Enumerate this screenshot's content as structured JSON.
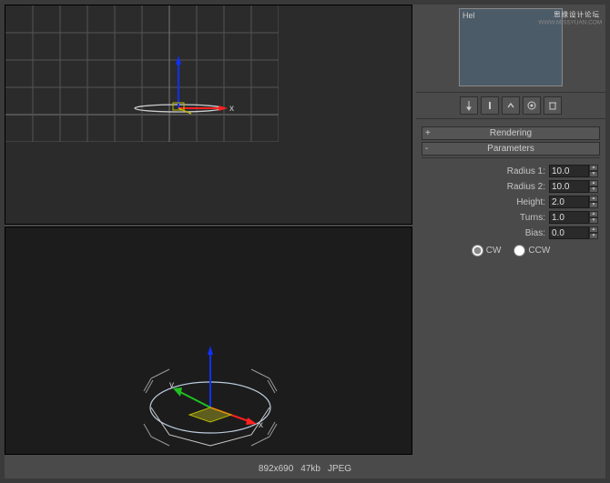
{
  "preview": {
    "label": "Hel"
  },
  "watermark": {
    "line1": "思缘设计论坛",
    "line2": "WWW.MISSYUAN.COM"
  },
  "rollouts": {
    "rendering": {
      "title": "Rendering"
    },
    "parameters": {
      "title": "Parameters",
      "fields": {
        "radius1": {
          "label": "Radius 1:",
          "value": "10.0"
        },
        "radius2": {
          "label": "Radius 2:",
          "value": "10.0"
        },
        "height": {
          "label": "Height:",
          "value": "2.0"
        },
        "turns": {
          "label": "Turns:",
          "value": "1.0"
        },
        "bias": {
          "label": "Bias:",
          "value": "0.0"
        }
      },
      "direction": {
        "cw": "CW",
        "ccw": "CCW",
        "selected": "cw"
      }
    }
  },
  "axis_labels": {
    "x": "x",
    "y": "y"
  },
  "footer": {
    "dims": "892x690",
    "size": "47kb",
    "fmt": "JPEG"
  }
}
